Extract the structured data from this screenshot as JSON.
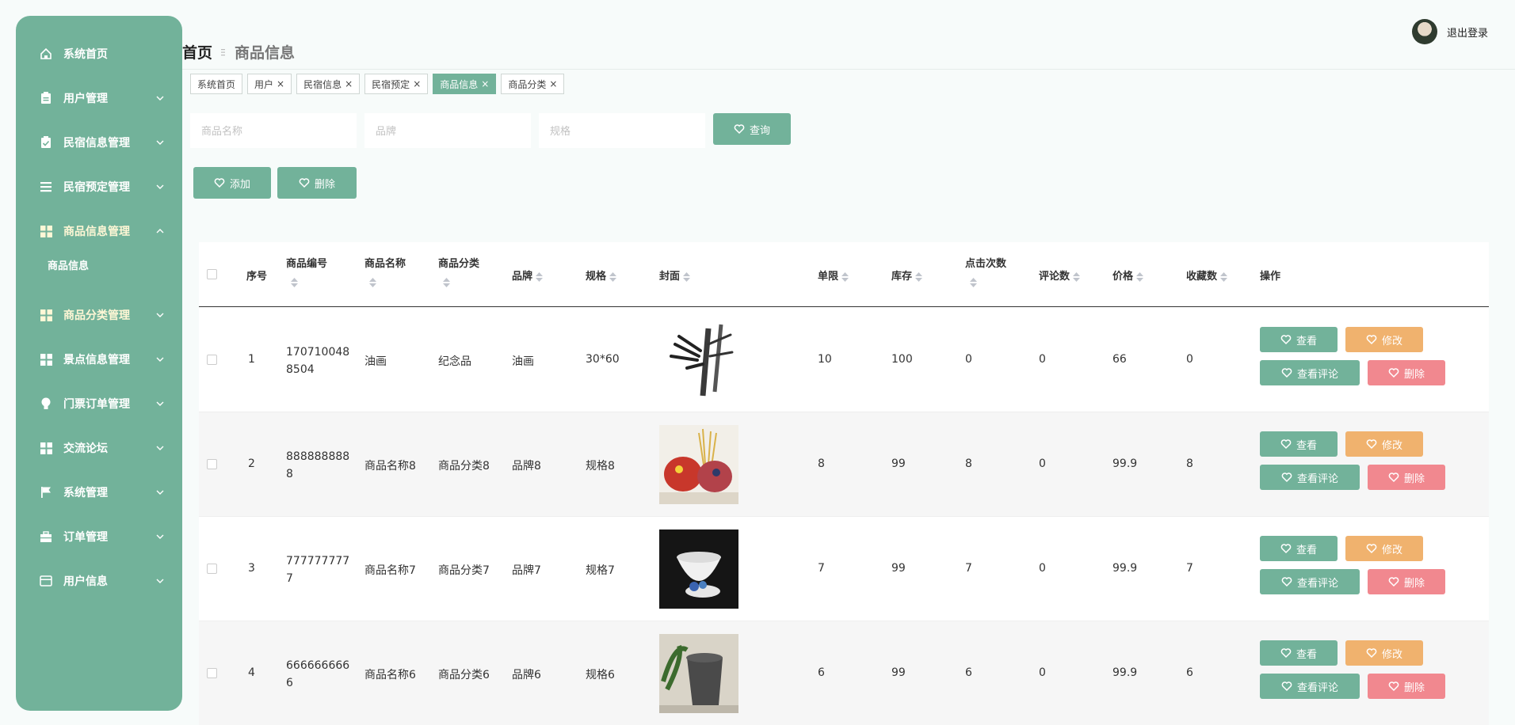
{
  "sidebar": {
    "items": [
      {
        "label": "系统首页",
        "icon": "home-icon"
      },
      {
        "label": "用户管理",
        "icon": "clipboard-icon"
      },
      {
        "label": "民宿信息管理",
        "icon": "clipboard-check-icon"
      },
      {
        "label": "民宿预定管理",
        "icon": "list-icon"
      },
      {
        "label": "商品信息管理",
        "icon": "grid-icon"
      },
      {
        "label": "商品分类管理",
        "icon": "grid-icon"
      },
      {
        "label": "景点信息管理",
        "icon": "grid-icon"
      },
      {
        "label": "门票订单管理",
        "icon": "bulb-icon"
      },
      {
        "label": "交流论坛",
        "icon": "grid-icon"
      },
      {
        "label": "系统管理",
        "icon": "flag-icon"
      },
      {
        "label": "订单管理",
        "icon": "briefcase-icon"
      },
      {
        "label": "用户信息",
        "icon": "card-icon"
      }
    ],
    "sub_item": "商品信息"
  },
  "header": {
    "breadcrumb_home": "首页",
    "breadcrumb_current": "商品信息",
    "logout": "退出登录"
  },
  "tags": [
    {
      "label": "系统首页"
    },
    {
      "label": "用户"
    },
    {
      "label": "民宿信息"
    },
    {
      "label": "民宿预定"
    },
    {
      "label": "商品信息"
    },
    {
      "label": "商品分类"
    }
  ],
  "tag_close": "×",
  "search": {
    "name_placeholder": "商品名称",
    "brand_placeholder": "品牌",
    "spec_placeholder": "规格",
    "query": "查询"
  },
  "actions": {
    "add": "添加",
    "delete": "删除"
  },
  "table": {
    "headers": [
      "序号",
      "商品编号",
      "商品名称",
      "商品分类",
      "品牌",
      "规格",
      "封面",
      "单限",
      "库存",
      "点击次数",
      "评论数",
      "价格",
      "收藏数",
      "操作"
    ],
    "row_actions": {
      "view": "查看",
      "edit": "修改",
      "view_comments": "查看评论",
      "delete": "删除"
    },
    "rows": [
      {
        "idx": "1",
        "code1": "170710048",
        "code2": "8504",
        "name": "油画",
        "category": "纪念品",
        "brand": "油画",
        "spec": "30*60",
        "limit": "10",
        "stock": "100",
        "clicks": "0",
        "comments": "0",
        "price": "66",
        "favs": "0",
        "cover": "bamboo-painting"
      },
      {
        "idx": "2",
        "code1": "888888888",
        "code2": "8",
        "name": "商品名称8",
        "category": "商品分类8",
        "brand": "品牌8",
        "spec": "规格8",
        "limit": "8",
        "stock": "99",
        "clicks": "8",
        "comments": "0",
        "price": "99.9",
        "favs": "8",
        "cover": "clay-figurines"
      },
      {
        "idx": "3",
        "code1": "777777777",
        "code2": "7",
        "name": "商品名称7",
        "category": "商品分类7",
        "brand": "品牌7",
        "spec": "规格7",
        "limit": "7",
        "stock": "99",
        "clicks": "7",
        "comments": "0",
        "price": "99.9",
        "favs": "7",
        "cover": "tea-bowl"
      },
      {
        "idx": "4",
        "code1": "666666666",
        "code2": "6",
        "name": "商品名称6",
        "category": "商品分类6",
        "brand": "品牌6",
        "spec": "规格6",
        "limit": "6",
        "stock": "99",
        "clicks": "6",
        "comments": "0",
        "price": "99.9",
        "favs": "6",
        "cover": "stone-mortar"
      }
    ]
  },
  "colors": {
    "primary": "#72b29a",
    "warning": "#f0b26e",
    "danger": "#f1888f"
  }
}
